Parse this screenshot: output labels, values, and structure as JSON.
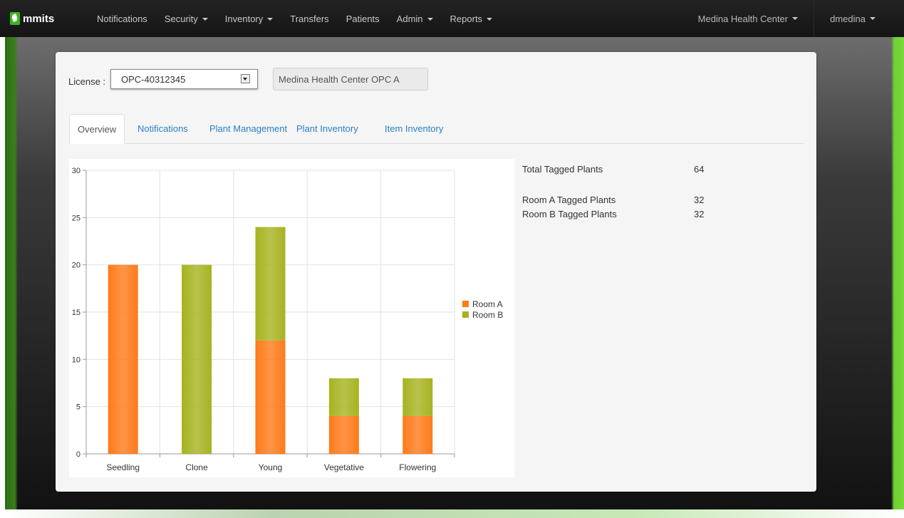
{
  "brand": "mmits",
  "nav": [
    {
      "label": "Notifications",
      "dropdown": false
    },
    {
      "label": "Security",
      "dropdown": true
    },
    {
      "label": "Inventory",
      "dropdown": true
    },
    {
      "label": "Transfers",
      "dropdown": false
    },
    {
      "label": "Patients",
      "dropdown": false
    },
    {
      "label": "Admin",
      "dropdown": true
    },
    {
      "label": "Reports",
      "dropdown": true
    }
  ],
  "facility_menu": "Medina Health Center",
  "user_menu": "dmedina",
  "license": {
    "label": "License :",
    "selected": "OPC-40312345",
    "facility_name": "Medina Health Center OPC A"
  },
  "tabs": [
    "Overview",
    "Notifications",
    "Plant Management",
    "Plant Inventory",
    "Item Inventory"
  ],
  "active_tab": "Overview",
  "stats": [
    {
      "label": "Total Tagged Plants",
      "value": "64"
    },
    {
      "label": "Room A Tagged Plants",
      "value": "32"
    },
    {
      "label": "Room B Tagged Plants",
      "value": "32"
    }
  ],
  "colors": {
    "room_a": "#ff7a1a",
    "room_b": "#a6b31f",
    "link": "#2a80c8"
  },
  "chart_data": {
    "type": "bar",
    "stacked": true,
    "categories": [
      "Seedling",
      "Clone",
      "Young",
      "Vegetative",
      "Flowering"
    ],
    "series": [
      {
        "name": "Room A",
        "values": [
          20,
          0,
          12,
          4,
          4
        ]
      },
      {
        "name": "Room B",
        "values": [
          0,
          20,
          12,
          4,
          4
        ]
      }
    ],
    "ylim": [
      0,
      30
    ],
    "yticks": [
      0,
      5,
      10,
      15,
      20,
      25,
      30
    ],
    "grid": true,
    "legend": "right"
  }
}
